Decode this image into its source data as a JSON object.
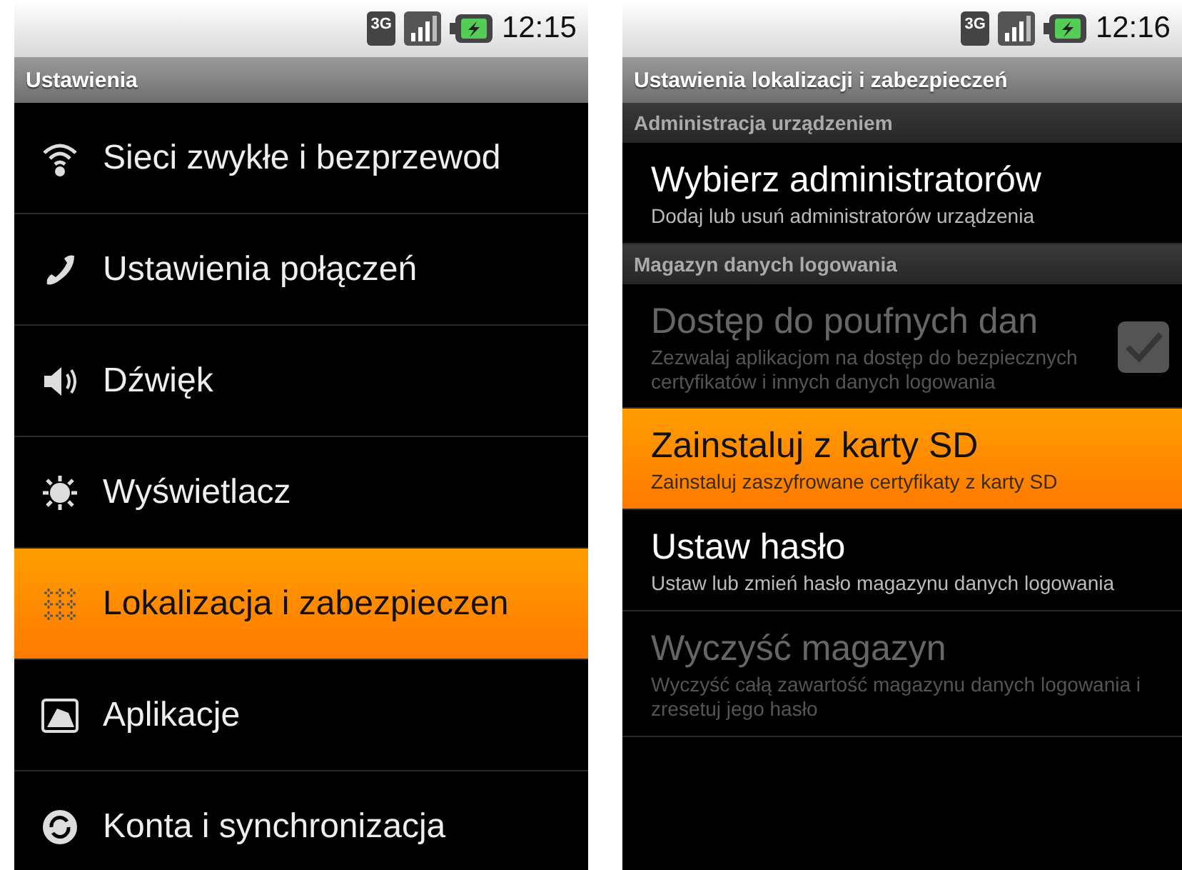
{
  "screens": [
    {
      "status_bar": {
        "network": "3G",
        "time": "12:15"
      },
      "title": "Ustawienia",
      "items": [
        {
          "kind": "menu",
          "label": "Sieci zwykłe i bezprzewod",
          "selected": false
        },
        {
          "kind": "menu",
          "label": "Ustawienia połączeń",
          "selected": false
        },
        {
          "kind": "menu",
          "label": "Dźwięk",
          "selected": false
        },
        {
          "kind": "menu",
          "label": "Wyświetlacz",
          "selected": false
        },
        {
          "kind": "menu",
          "label": "Lokalizacja i zabezpieczen",
          "selected": true
        },
        {
          "kind": "menu",
          "label": "Aplikacje",
          "selected": false
        },
        {
          "kind": "menu",
          "label": "Konta i synchronizacja",
          "selected": false
        }
      ]
    },
    {
      "status_bar": {
        "network": "3G",
        "time": "12:16"
      },
      "title": "Ustawienia lokalizacji i zabezpieczeń",
      "items": [
        {
          "kind": "section",
          "label": "Administracja urządzeniem"
        },
        {
          "kind": "setting",
          "label": "Wybierz administratorów",
          "summary": "Dodaj lub usuń administratorów urządzenia",
          "selected": false,
          "disabled": false
        },
        {
          "kind": "section",
          "label": "Magazyn danych logowania"
        },
        {
          "kind": "checkbox",
          "label": "Dostęp do poufnych dan",
          "summary": "Zezwalaj aplikacjom na dostęp do bezpiecznych certyfikatów i innych danych logowania",
          "selected": false,
          "disabled": true,
          "checked": true
        },
        {
          "kind": "setting",
          "label": "Zainstaluj z karty SD",
          "summary": "Zainstaluj zaszyfrowane certyfikaty z karty SD",
          "selected": true,
          "disabled": false
        },
        {
          "kind": "setting",
          "label": "Ustaw hasło",
          "summary": "Ustaw lub zmień hasło magazynu danych logowania",
          "selected": false,
          "disabled": false
        },
        {
          "kind": "setting",
          "label": "Wyczyść magazyn",
          "summary": "Wyczyść całą zawartość magazynu danych logowania i zresetuj jego hasło",
          "selected": false,
          "disabled": true
        }
      ]
    }
  ]
}
